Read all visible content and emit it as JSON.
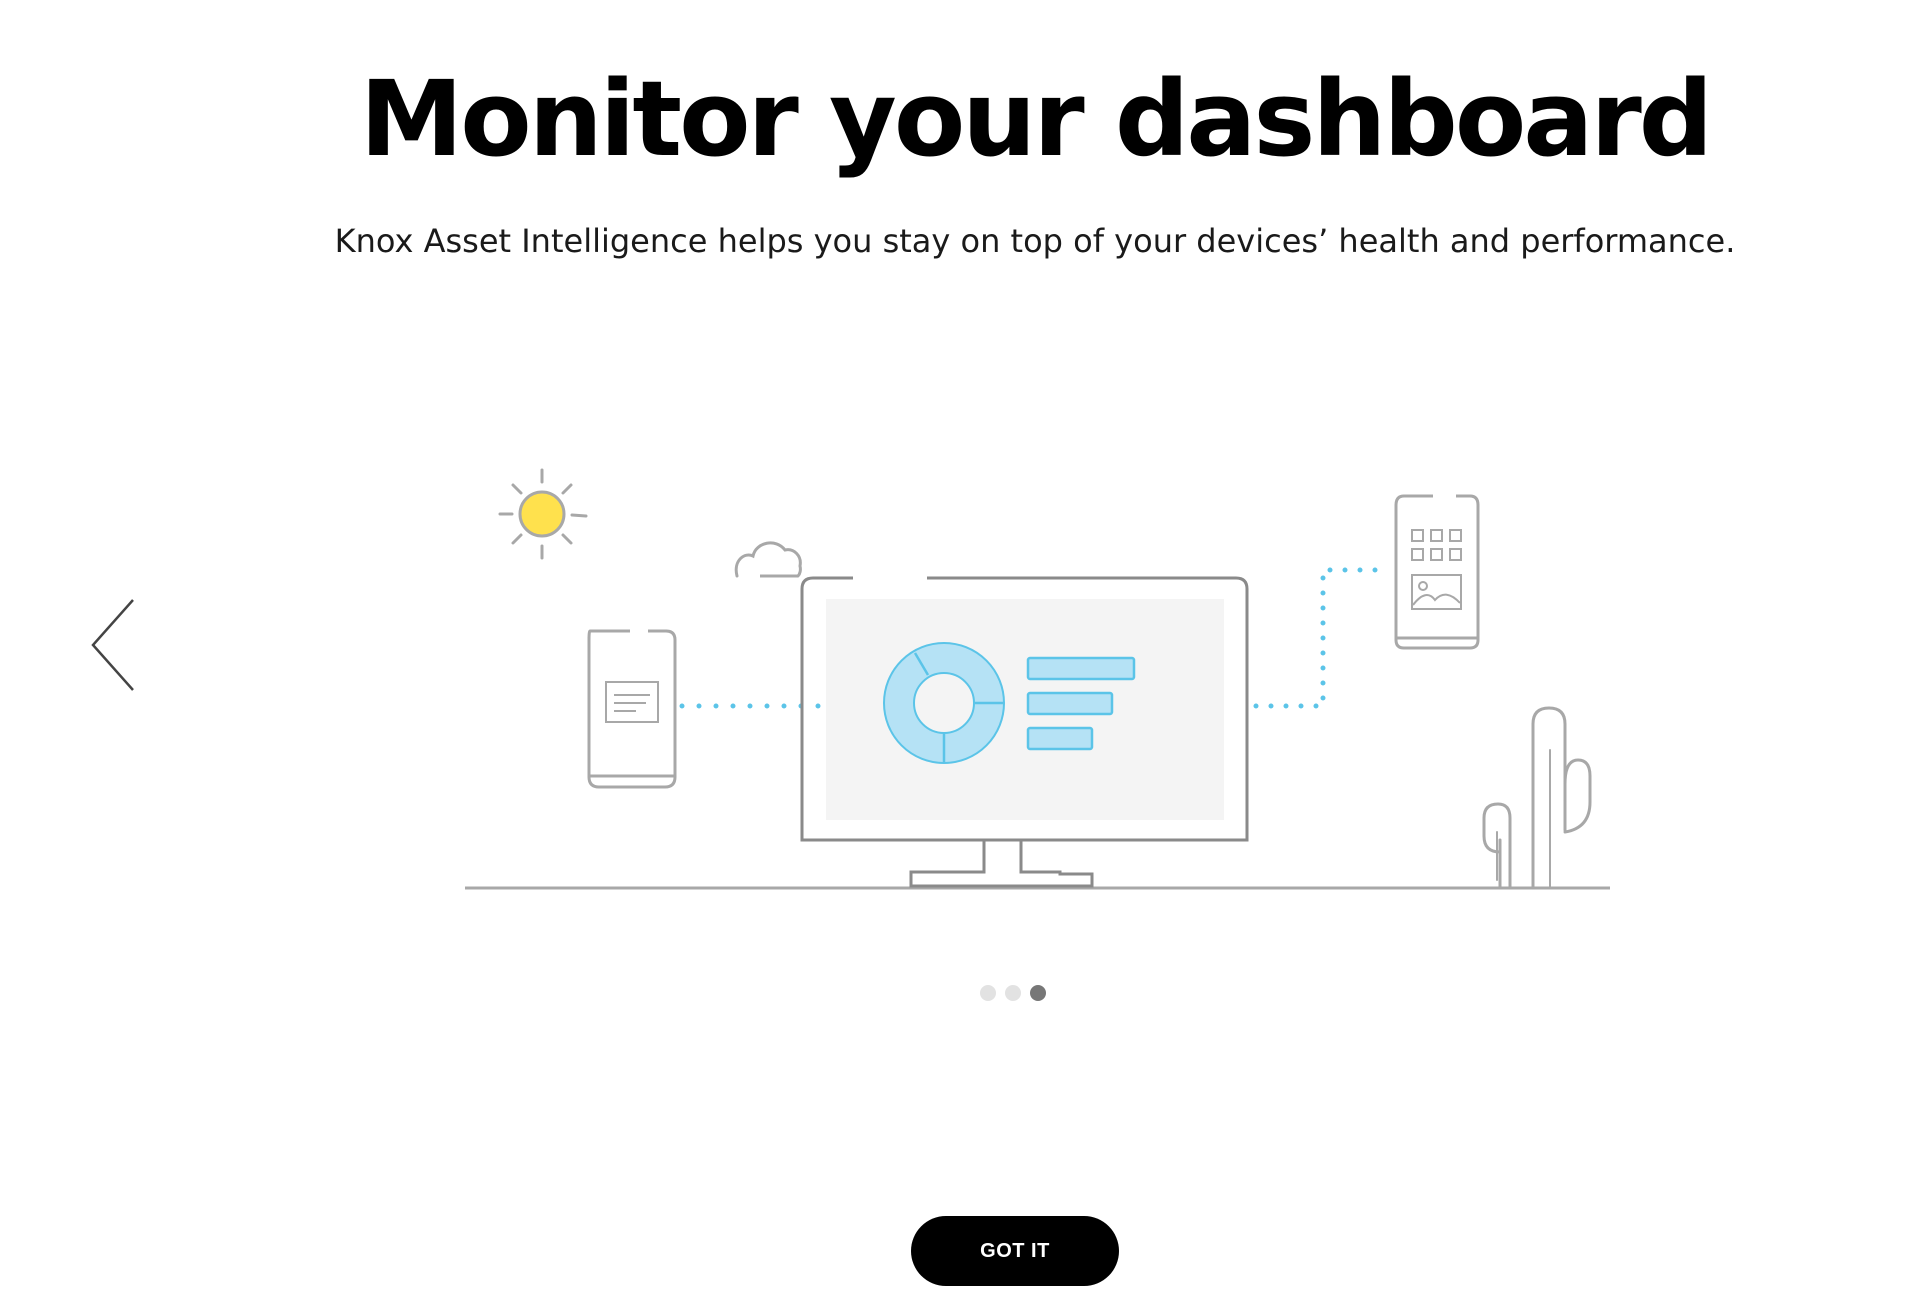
{
  "onboarding": {
    "title": "Monitor your dashboard",
    "subtitle": "Knox Asset Intelligence helps you stay on top of your devices’ health and performance.",
    "button_label": "GOT IT",
    "pagination": {
      "total": 3,
      "active_index": 2
    }
  },
  "icons": {
    "prev": "chevron-left-icon"
  },
  "colors": {
    "accent_blue": "#5bc4e8",
    "chart_fill": "#b5e2f5",
    "sun_yellow": "#ffe14d",
    "line_gray": "#999999",
    "button_bg": "#000000",
    "button_text": "#ffffff"
  }
}
